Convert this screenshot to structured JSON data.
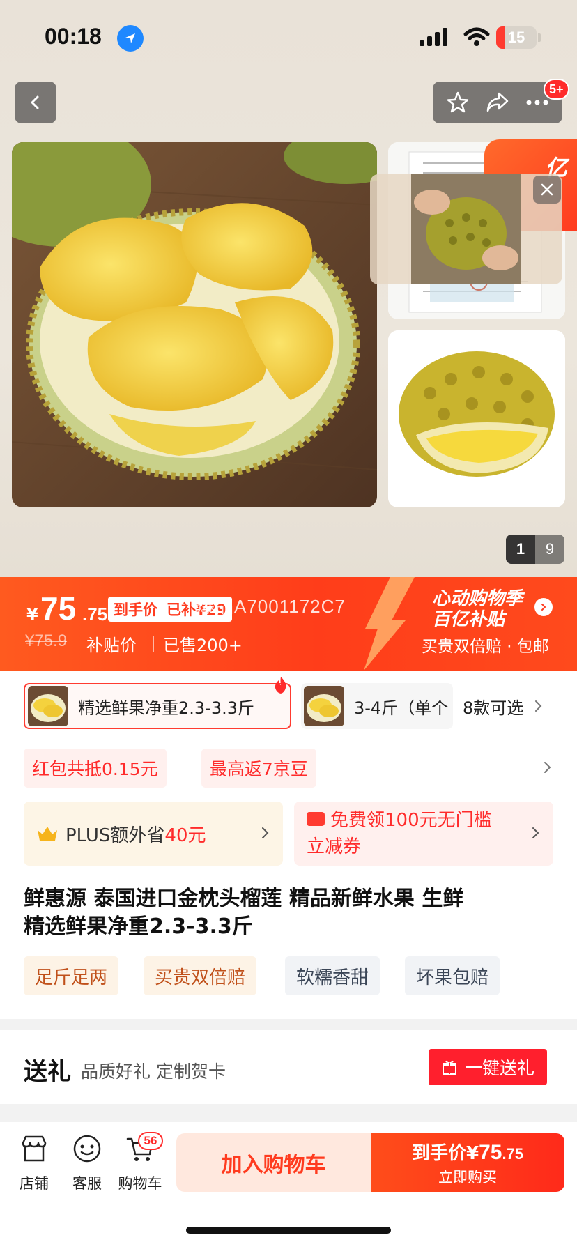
{
  "status_bar": {
    "time": "00:18",
    "battery": "15",
    "icons": [
      "location-arrow-icon",
      "signal-icon",
      "wifi-icon",
      "battery-icon"
    ]
  },
  "header": {
    "back_icon": "chevron-left-icon",
    "actions": [
      "star-icon",
      "share-icon",
      "more-icon"
    ],
    "more_badge": "5+"
  },
  "gallery": {
    "promo_corner": "亿",
    "page_current": "1",
    "page_total": "9"
  },
  "price_banner": {
    "currency": "¥",
    "price_int": "75",
    "price_dec": ".75",
    "tag_label": "到手价",
    "tag_subsidy": "已补¥29",
    "overlay_code": "爆品A7001172C7",
    "original_price": "¥75.9",
    "subsidy_label": "补贴价",
    "sold": "已售200+",
    "promo_title_1": "心动购物季",
    "promo_title_2": "百亿补贴",
    "promo_sub": "买贵双倍赔 · 包邮"
  },
  "sku": {
    "selected_label": "精选鲜果净重2.3-3.3斤",
    "other_label": "3-4斤（单个",
    "more_label": "8款可选"
  },
  "coupons": [
    "红包共抵0.15元",
    "最高返7京豆"
  ],
  "benefits": {
    "plus_prefix": "PLUS额外省",
    "plus_amount": "40元",
    "free_line1": "免费领100元无门槛",
    "free_line2": "立减券"
  },
  "product": {
    "title_line1": "鲜惠源 泰国进口金枕头榴莲 精品新鲜水果 生鲜",
    "title_line2": "精选鲜果净重2.3-3.3斤",
    "tags": [
      "足斤足两",
      "买贵双倍赔",
      "软糯香甜",
      "坏果包赔"
    ]
  },
  "gift": {
    "title": "送礼",
    "subtitle": "品质好礼 定制贺卡",
    "button": "一键送礼"
  },
  "bottom_bar": {
    "tabs": [
      {
        "label": "店铺",
        "icon": "store-icon"
      },
      {
        "label": "客服",
        "icon": "customer-service-icon"
      },
      {
        "label": "购物车",
        "icon": "cart-icon"
      }
    ],
    "cart_badge": "56",
    "add_to_cart": "加入购物车",
    "buy_prefix": "到手价¥",
    "buy_int": "75",
    "buy_dec": ".75",
    "buy_now": "立即购买"
  },
  "colors": {
    "brand_red": "#ff3b1f",
    "buy_gradient_start": "#ff4d1a",
    "coupon_bg": "#fff0ee",
    "plus_bg": "#fdf5e6"
  }
}
